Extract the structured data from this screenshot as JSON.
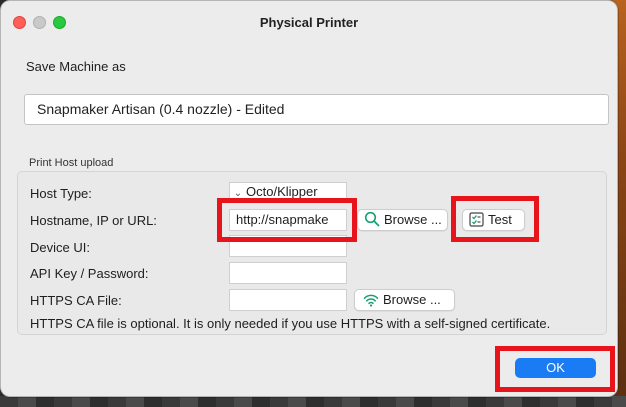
{
  "window": {
    "title": "Physical Printer"
  },
  "machine": {
    "save_label": "Save Machine as",
    "name_value": "Snapmaker Artisan (0.4 nozzle) - Edited"
  },
  "print_host": {
    "group_label": "Print Host upload",
    "host_type_label": "Host Type:",
    "host_type_value": "Octo/Klipper",
    "hostname_label": "Hostname, IP or URL:",
    "hostname_value": "http://snapmake",
    "device_ui_label": "Device UI:",
    "device_ui_value": "",
    "api_key_label": "API Key / Password:",
    "api_key_value": "",
    "ca_file_label": "HTTPS CA File:",
    "ca_file_value": "",
    "browse_label": "Browse ...",
    "test_label": "Test",
    "ca_browse_label": "Browse ...",
    "ca_note": "HTTPS CA file is optional. It is only needed if you use HTTPS with a self-signed certificate."
  },
  "footer": {
    "ok_label": "OK"
  },
  "icons": {
    "browse": "search-icon",
    "test": "test-check-icon",
    "ca_browse": "wifi-icon",
    "host_type_dropdown": "chevron-down-icon"
  },
  "colors": {
    "highlight": "#e8141b",
    "primary_button": "#1a7cf5",
    "accent_icon": "#18a070"
  }
}
